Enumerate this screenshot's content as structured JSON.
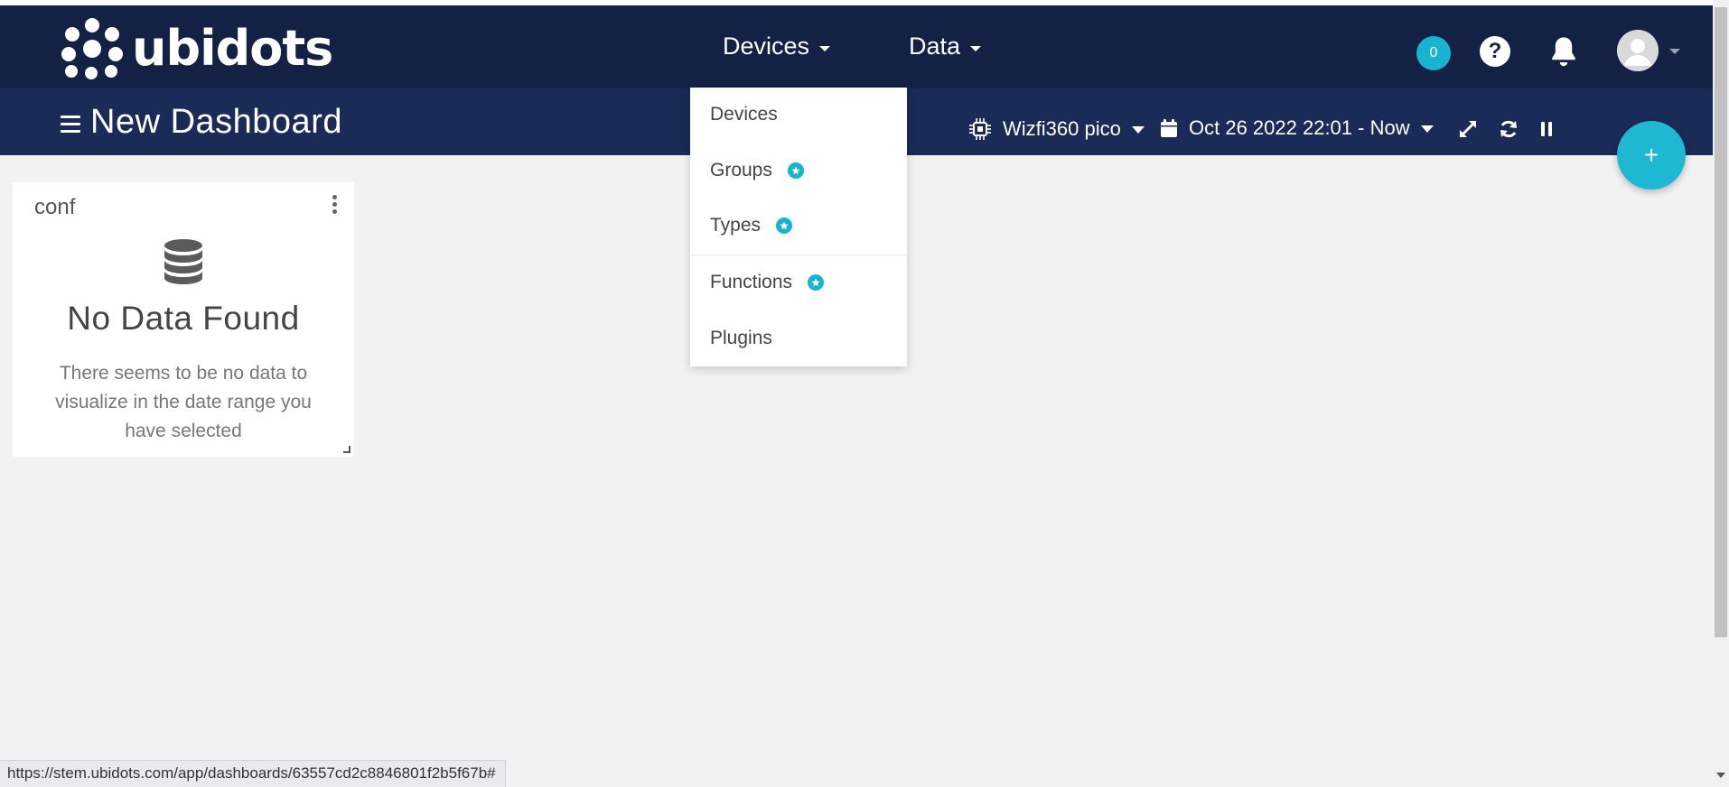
{
  "brand": {
    "logo_text": "ubidots"
  },
  "nav": {
    "devices_label": "Devices",
    "data_label": "Data"
  },
  "header": {
    "notification_count": "0",
    "help_glyph": "?"
  },
  "dashboard": {
    "title": "New Dashboard",
    "device_selector": "Wizfi360 pico",
    "date_range": "Oct 26 2022 22:01 - Now",
    "add_glyph": "+"
  },
  "widget": {
    "title": "conf",
    "empty_title": "No Data Found",
    "empty_message": "There seems to be no data to visualize in the date range you have selected"
  },
  "devices_menu": {
    "items": [
      {
        "label": "Devices",
        "badge": false
      },
      {
        "label": "Groups",
        "badge": true
      },
      {
        "label": "Types",
        "badge": true
      },
      {
        "label": "Functions",
        "badge": true
      },
      {
        "label": "Plugins",
        "badge": false
      }
    ]
  },
  "status_bar": {
    "url": "https://stem.ubidots.com/app/dashboards/63557cd2c8846801f2b5f67b#"
  },
  "colors": {
    "topbar": "#132144",
    "subbar": "#1b2b57",
    "accent": "#18b4cf",
    "background": "#f2f2f2"
  },
  "icons": {
    "menu": "hamburger-icon",
    "device": "chip-icon",
    "calendar": "calendar-icon",
    "expand": "expand-icon",
    "refresh": "refresh-icon",
    "pause": "pause-icon",
    "bell": "bell-icon",
    "help": "help-icon",
    "widget_empty": "database-icon",
    "star": "star-icon"
  }
}
